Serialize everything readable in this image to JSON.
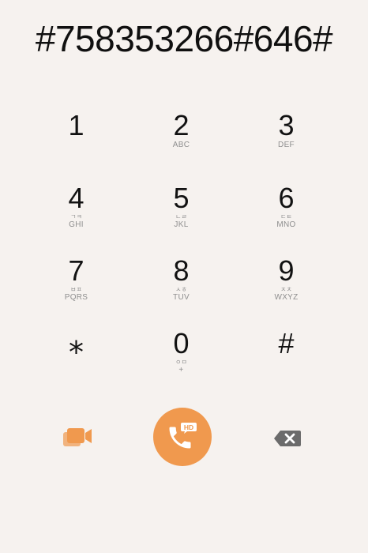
{
  "dialer": {
    "number": "#758353266#646#"
  },
  "keypad": {
    "keys": [
      {
        "digit": "1",
        "hangul": "",
        "letters": ""
      },
      {
        "digit": "2",
        "hangul": "",
        "letters": "ABC"
      },
      {
        "digit": "3",
        "hangul": "",
        "letters": "DEF"
      },
      {
        "digit": "4",
        "hangul": "ㄱㅋ",
        "letters": "GHI"
      },
      {
        "digit": "5",
        "hangul": "ㄴㄹ",
        "letters": "JKL"
      },
      {
        "digit": "6",
        "hangul": "ㄷㅌ",
        "letters": "MNO"
      },
      {
        "digit": "7",
        "hangul": "ㅂㅍ",
        "letters": "PQRS"
      },
      {
        "digit": "8",
        "hangul": "ㅅㅎ",
        "letters": "TUV"
      },
      {
        "digit": "9",
        "hangul": "ㅈㅊ",
        "letters": "WXYZ"
      },
      {
        "digit": "⁎",
        "hangul": "",
        "letters": ""
      },
      {
        "digit": "0",
        "hangul": "ㅇㅁ",
        "letters": "+"
      },
      {
        "digit": "#",
        "hangul": "",
        "letters": ""
      }
    ]
  },
  "actions": {
    "video_icon": "video-call-icon",
    "call_icon": "phone-icon",
    "call_badge": "HD",
    "delete_icon": "backspace-icon"
  },
  "colors": {
    "background": "#f6f2ef",
    "accent": "#f0994e",
    "delete_grey": "#6b6b6b"
  }
}
